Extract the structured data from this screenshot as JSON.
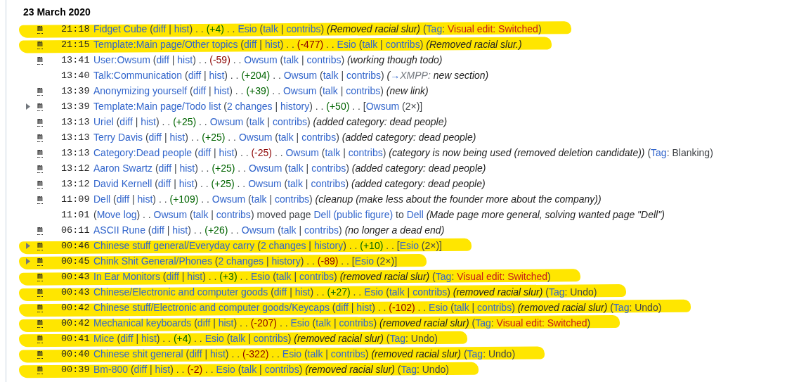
{
  "day": {
    "heading": "23 March 2020"
  },
  "rows": [
    {
      "highlighted": true,
      "expandable": false,
      "minor_flag": "m",
      "time": "21:18",
      "parts": [
        {
          "kind": "link",
          "text": "Fidget Cube"
        },
        {
          "kind": "text",
          "text": " ("
        },
        {
          "kind": "link",
          "text": "diff"
        },
        {
          "kind": "text",
          "text": " | "
        },
        {
          "kind": "link",
          "text": "hist"
        },
        {
          "kind": "text",
          "text": ") . . "
        },
        {
          "kind": "plus",
          "text": "(+4)"
        },
        {
          "kind": "text",
          "text": " . . "
        },
        {
          "kind": "link",
          "text": "Esio"
        },
        {
          "kind": "text",
          "text": " ("
        },
        {
          "kind": "link",
          "text": "talk"
        },
        {
          "kind": "text",
          "text": " | "
        },
        {
          "kind": "link",
          "text": "contribs"
        },
        {
          "kind": "text",
          "text": ") "
        },
        {
          "kind": "comment",
          "text": "(Removed racial slur)"
        },
        {
          "kind": "text",
          "text": " ("
        },
        {
          "kind": "link",
          "text": "Tag"
        },
        {
          "kind": "text",
          "text": ": "
        },
        {
          "kind": "tag",
          "text": "Visual edit: Switched"
        },
        {
          "kind": "text",
          "text": ")"
        }
      ]
    },
    {
      "highlighted": true,
      "expandable": false,
      "minor_flag": "m",
      "time": "21:15",
      "parts": [
        {
          "kind": "link",
          "text": "Template:Main page/Other topics"
        },
        {
          "kind": "text",
          "text": " ("
        },
        {
          "kind": "link",
          "text": "diff"
        },
        {
          "kind": "text",
          "text": " | "
        },
        {
          "kind": "link",
          "text": "hist"
        },
        {
          "kind": "text",
          "text": ") . . "
        },
        {
          "kind": "minus",
          "text": "(-477)"
        },
        {
          "kind": "text",
          "text": " . . "
        },
        {
          "kind": "link",
          "text": "Esio"
        },
        {
          "kind": "text",
          "text": " ("
        },
        {
          "kind": "link",
          "text": "talk"
        },
        {
          "kind": "text",
          "text": " | "
        },
        {
          "kind": "link",
          "text": "contribs"
        },
        {
          "kind": "text",
          "text": ") "
        },
        {
          "kind": "comment",
          "text": "(Removed racial slur.)"
        }
      ]
    },
    {
      "highlighted": false,
      "expandable": false,
      "minor_flag": "m",
      "time": "13:41",
      "parts": [
        {
          "kind": "link",
          "text": "User:Owsum"
        },
        {
          "kind": "text",
          "text": " ("
        },
        {
          "kind": "link",
          "text": "diff"
        },
        {
          "kind": "text",
          "text": " | "
        },
        {
          "kind": "link",
          "text": "hist"
        },
        {
          "kind": "text",
          "text": ") . . "
        },
        {
          "kind": "minus",
          "text": "(-59)"
        },
        {
          "kind": "text",
          "text": " . . "
        },
        {
          "kind": "link",
          "text": "Owsum"
        },
        {
          "kind": "text",
          "text": " ("
        },
        {
          "kind": "link",
          "text": "talk"
        },
        {
          "kind": "text",
          "text": " | "
        },
        {
          "kind": "link",
          "text": "contribs"
        },
        {
          "kind": "text",
          "text": ") "
        },
        {
          "kind": "comment",
          "text": "(working though todo)"
        }
      ]
    },
    {
      "highlighted": false,
      "expandable": false,
      "time": "13:40",
      "parts": [
        {
          "kind": "link",
          "text": "Talk:Communication"
        },
        {
          "kind": "text",
          "text": " ("
        },
        {
          "kind": "link",
          "text": "diff"
        },
        {
          "kind": "text",
          "text": " | "
        },
        {
          "kind": "link",
          "text": "hist"
        },
        {
          "kind": "text",
          "text": ") . . "
        },
        {
          "kind": "plus",
          "text": "(+204)"
        },
        {
          "kind": "text",
          "text": " . . "
        },
        {
          "kind": "link",
          "text": "Owsum"
        },
        {
          "kind": "text",
          "text": " ("
        },
        {
          "kind": "link",
          "text": "talk"
        },
        {
          "kind": "text",
          "text": " | "
        },
        {
          "kind": "link",
          "text": "contribs"
        },
        {
          "kind": "text",
          "text": ") "
        },
        {
          "kind": "comment",
          "text": "("
        },
        {
          "kind": "link",
          "text": "→"
        },
        {
          "kind": "muted",
          "text": "XMPP:"
        },
        {
          "kind": "comment",
          "text": " new section)"
        }
      ]
    },
    {
      "highlighted": false,
      "expandable": false,
      "minor_flag": "m",
      "time": "13:39",
      "parts": [
        {
          "kind": "link",
          "text": "Anonymizing yourself"
        },
        {
          "kind": "text",
          "text": " ("
        },
        {
          "kind": "link",
          "text": "diff"
        },
        {
          "kind": "text",
          "text": " | "
        },
        {
          "kind": "link",
          "text": "hist"
        },
        {
          "kind": "text",
          "text": ") . . "
        },
        {
          "kind": "plus",
          "text": "(+39)"
        },
        {
          "kind": "text",
          "text": " . . "
        },
        {
          "kind": "link",
          "text": "Owsum"
        },
        {
          "kind": "text",
          "text": " ("
        },
        {
          "kind": "link",
          "text": "talk"
        },
        {
          "kind": "text",
          "text": " | "
        },
        {
          "kind": "link",
          "text": "contribs"
        },
        {
          "kind": "text",
          "text": ") "
        },
        {
          "kind": "comment",
          "text": "(new link)"
        }
      ]
    },
    {
      "highlighted": false,
      "expandable": true,
      "minor_flag": "m",
      "time": "13:39",
      "parts": [
        {
          "kind": "link",
          "text": "Template:Main page/Todo list"
        },
        {
          "kind": "text",
          "text": " ("
        },
        {
          "kind": "link",
          "text": "2 changes"
        },
        {
          "kind": "text",
          "text": " | "
        },
        {
          "kind": "link",
          "text": "history"
        },
        {
          "kind": "text",
          "text": ") . . "
        },
        {
          "kind": "plus",
          "text": "(+50)"
        },
        {
          "kind": "text",
          "text": " . . ["
        },
        {
          "kind": "link",
          "text": "Owsum"
        },
        {
          "kind": "text",
          "text": " (2×)]"
        }
      ]
    },
    {
      "highlighted": false,
      "expandable": false,
      "minor_flag": "m",
      "time": "13:13",
      "parts": [
        {
          "kind": "link",
          "text": "Uriel"
        },
        {
          "kind": "text",
          "text": " ("
        },
        {
          "kind": "link",
          "text": "diff"
        },
        {
          "kind": "text",
          "text": " | "
        },
        {
          "kind": "link",
          "text": "hist"
        },
        {
          "kind": "text",
          "text": ") . . "
        },
        {
          "kind": "plus",
          "text": "(+25)"
        },
        {
          "kind": "text",
          "text": " . . "
        },
        {
          "kind": "link",
          "text": "Owsum"
        },
        {
          "kind": "text",
          "text": " ("
        },
        {
          "kind": "link",
          "text": "talk"
        },
        {
          "kind": "text",
          "text": " | "
        },
        {
          "kind": "link",
          "text": "contribs"
        },
        {
          "kind": "text",
          "text": ") "
        },
        {
          "kind": "comment",
          "text": "(added category: dead people)"
        }
      ]
    },
    {
      "highlighted": false,
      "expandable": false,
      "minor_flag": "m",
      "time": "13:13",
      "parts": [
        {
          "kind": "link",
          "text": "Terry Davis"
        },
        {
          "kind": "text",
          "text": " ("
        },
        {
          "kind": "link",
          "text": "diff"
        },
        {
          "kind": "text",
          "text": " | "
        },
        {
          "kind": "link",
          "text": "hist"
        },
        {
          "kind": "text",
          "text": ") . . "
        },
        {
          "kind": "plus",
          "text": "(+25)"
        },
        {
          "kind": "text",
          "text": " . . "
        },
        {
          "kind": "link",
          "text": "Owsum"
        },
        {
          "kind": "text",
          "text": " ("
        },
        {
          "kind": "link",
          "text": "talk"
        },
        {
          "kind": "text",
          "text": " | "
        },
        {
          "kind": "link",
          "text": "contribs"
        },
        {
          "kind": "text",
          "text": ") "
        },
        {
          "kind": "comment",
          "text": "(added category: dead people)"
        }
      ]
    },
    {
      "highlighted": false,
      "expandable": false,
      "minor_flag": "m",
      "time": "13:13",
      "parts": [
        {
          "kind": "link",
          "text": "Category:Dead people"
        },
        {
          "kind": "text",
          "text": " ("
        },
        {
          "kind": "link",
          "text": "diff"
        },
        {
          "kind": "text",
          "text": " | "
        },
        {
          "kind": "link",
          "text": "hist"
        },
        {
          "kind": "text",
          "text": ") . . "
        },
        {
          "kind": "minus",
          "text": "(-25)"
        },
        {
          "kind": "text",
          "text": " . . "
        },
        {
          "kind": "link",
          "text": "Owsum"
        },
        {
          "kind": "text",
          "text": " ("
        },
        {
          "kind": "link",
          "text": "talk"
        },
        {
          "kind": "text",
          "text": " | "
        },
        {
          "kind": "link",
          "text": "contribs"
        },
        {
          "kind": "text",
          "text": ") "
        },
        {
          "kind": "comment",
          "text": "(category is now being used (removed deletion candidate))"
        },
        {
          "kind": "text",
          "text": " ("
        },
        {
          "kind": "link",
          "text": "Tag"
        },
        {
          "kind": "text",
          "text": ": Blanking)"
        }
      ]
    },
    {
      "highlighted": false,
      "expandable": false,
      "minor_flag": "m",
      "time": "13:12",
      "parts": [
        {
          "kind": "link",
          "text": "Aaron Swartz"
        },
        {
          "kind": "text",
          "text": " ("
        },
        {
          "kind": "link",
          "text": "diff"
        },
        {
          "kind": "text",
          "text": " | "
        },
        {
          "kind": "link",
          "text": "hist"
        },
        {
          "kind": "text",
          "text": ") . . "
        },
        {
          "kind": "plus",
          "text": "(+25)"
        },
        {
          "kind": "text",
          "text": " . . "
        },
        {
          "kind": "link",
          "text": "Owsum"
        },
        {
          "kind": "text",
          "text": " ("
        },
        {
          "kind": "link",
          "text": "talk"
        },
        {
          "kind": "text",
          "text": " | "
        },
        {
          "kind": "link",
          "text": "contribs"
        },
        {
          "kind": "text",
          "text": ") "
        },
        {
          "kind": "comment",
          "text": "(added category: dead people)"
        }
      ]
    },
    {
      "highlighted": false,
      "expandable": false,
      "minor_flag": "m",
      "time": "13:12",
      "parts": [
        {
          "kind": "link",
          "text": "David Kernell"
        },
        {
          "kind": "text",
          "text": " ("
        },
        {
          "kind": "link",
          "text": "diff"
        },
        {
          "kind": "text",
          "text": " | "
        },
        {
          "kind": "link",
          "text": "hist"
        },
        {
          "kind": "text",
          "text": ") . . "
        },
        {
          "kind": "plus",
          "text": "(+25)"
        },
        {
          "kind": "text",
          "text": " . . "
        },
        {
          "kind": "link",
          "text": "Owsum"
        },
        {
          "kind": "text",
          "text": " ("
        },
        {
          "kind": "link",
          "text": "talk"
        },
        {
          "kind": "text",
          "text": " | "
        },
        {
          "kind": "link",
          "text": "contribs"
        },
        {
          "kind": "text",
          "text": ") "
        },
        {
          "kind": "comment",
          "text": "(added category: dead people)"
        }
      ]
    },
    {
      "highlighted": false,
      "expandable": false,
      "minor_flag": "m",
      "time": "11:09",
      "parts": [
        {
          "kind": "link",
          "text": "Dell"
        },
        {
          "kind": "text",
          "text": " ("
        },
        {
          "kind": "link",
          "text": "diff"
        },
        {
          "kind": "text",
          "text": " | "
        },
        {
          "kind": "link",
          "text": "hist"
        },
        {
          "kind": "text",
          "text": ") . . "
        },
        {
          "kind": "plus",
          "text": "(+109)"
        },
        {
          "kind": "text",
          "text": " . . "
        },
        {
          "kind": "link",
          "text": "Owsum"
        },
        {
          "kind": "text",
          "text": " ("
        },
        {
          "kind": "link",
          "text": "talk"
        },
        {
          "kind": "text",
          "text": " | "
        },
        {
          "kind": "link",
          "text": "contribs"
        },
        {
          "kind": "text",
          "text": ") "
        },
        {
          "kind": "comment",
          "text": "(cleanup (make less about the founder more about the company))"
        }
      ]
    },
    {
      "highlighted": false,
      "expandable": false,
      "time": "11:01",
      "parts": [
        {
          "kind": "text",
          "text": "("
        },
        {
          "kind": "link",
          "text": "Move log"
        },
        {
          "kind": "text",
          "text": ") . . "
        },
        {
          "kind": "link",
          "text": "Owsum"
        },
        {
          "kind": "text",
          "text": " ("
        },
        {
          "kind": "link",
          "text": "talk"
        },
        {
          "kind": "text",
          "text": " | "
        },
        {
          "kind": "link",
          "text": "contribs"
        },
        {
          "kind": "text",
          "text": ") moved page "
        },
        {
          "kind": "link",
          "text": "Dell (public figure)"
        },
        {
          "kind": "text",
          "text": " to "
        },
        {
          "kind": "link",
          "text": "Dell"
        },
        {
          "kind": "comment",
          "text": " (Made page more general, solving wanted page \"Dell\")"
        }
      ]
    },
    {
      "highlighted": false,
      "expandable": false,
      "minor_flag": "m",
      "time": "06:11",
      "parts": [
        {
          "kind": "link",
          "text": "ASCII Rune"
        },
        {
          "kind": "text",
          "text": " ("
        },
        {
          "kind": "link",
          "text": "diff"
        },
        {
          "kind": "text",
          "text": " | "
        },
        {
          "kind": "link",
          "text": "hist"
        },
        {
          "kind": "text",
          "text": ") . . "
        },
        {
          "kind": "plus",
          "text": "(+26)"
        },
        {
          "kind": "text",
          "text": " . . "
        },
        {
          "kind": "link",
          "text": "Owsum"
        },
        {
          "kind": "text",
          "text": " ("
        },
        {
          "kind": "link",
          "text": "talk"
        },
        {
          "kind": "text",
          "text": " | "
        },
        {
          "kind": "link",
          "text": "contribs"
        },
        {
          "kind": "text",
          "text": ") "
        },
        {
          "kind": "comment",
          "text": "(no longer a dead end)"
        }
      ]
    },
    {
      "highlighted": true,
      "expandable": true,
      "minor_flag": "m",
      "time": "00:46",
      "parts": [
        {
          "kind": "link",
          "text": "Chinese stuff general/Everyday carry"
        },
        {
          "kind": "text",
          "text": " ("
        },
        {
          "kind": "link",
          "text": "2 changes"
        },
        {
          "kind": "text",
          "text": " | "
        },
        {
          "kind": "link",
          "text": "history"
        },
        {
          "kind": "text",
          "text": ") . . "
        },
        {
          "kind": "plus",
          "text": "(+10)"
        },
        {
          "kind": "text",
          "text": " . . ["
        },
        {
          "kind": "link",
          "text": "Esio"
        },
        {
          "kind": "text",
          "text": " (2×)]"
        }
      ]
    },
    {
      "highlighted": true,
      "expandable": true,
      "minor_flag": "m",
      "time": "00:45",
      "parts": [
        {
          "kind": "link",
          "text": "Chink Shit General/Phones"
        },
        {
          "kind": "text",
          "text": " ("
        },
        {
          "kind": "link",
          "text": "2 changes"
        },
        {
          "kind": "text",
          "text": " | "
        },
        {
          "kind": "link",
          "text": "history"
        },
        {
          "kind": "text",
          "text": ") . . "
        },
        {
          "kind": "minus",
          "text": "(-89)"
        },
        {
          "kind": "text",
          "text": " . . ["
        },
        {
          "kind": "link",
          "text": "Esio"
        },
        {
          "kind": "text",
          "text": " (2×)]"
        }
      ]
    },
    {
      "highlighted": true,
      "expandable": false,
      "minor_flag": "m",
      "time": "00:43",
      "parts": [
        {
          "kind": "link",
          "text": "In Ear Monitors"
        },
        {
          "kind": "text",
          "text": " ("
        },
        {
          "kind": "link",
          "text": "diff"
        },
        {
          "kind": "text",
          "text": " | "
        },
        {
          "kind": "link",
          "text": "hist"
        },
        {
          "kind": "text",
          "text": ") . . "
        },
        {
          "kind": "plus",
          "text": "(+3)"
        },
        {
          "kind": "text",
          "text": " . . "
        },
        {
          "kind": "link",
          "text": "Esio"
        },
        {
          "kind": "text",
          "text": " ("
        },
        {
          "kind": "link",
          "text": "talk"
        },
        {
          "kind": "text",
          "text": " | "
        },
        {
          "kind": "link",
          "text": "contribs"
        },
        {
          "kind": "text",
          "text": ") "
        },
        {
          "kind": "comment",
          "text": "(removed racial slur)"
        },
        {
          "kind": "text",
          "text": " ("
        },
        {
          "kind": "link",
          "text": "Tag"
        },
        {
          "kind": "text",
          "text": ": "
        },
        {
          "kind": "tag",
          "text": "Visual edit: Switched"
        },
        {
          "kind": "text",
          "text": ")"
        }
      ]
    },
    {
      "highlighted": true,
      "expandable": false,
      "minor_flag": "m",
      "time": "00:43",
      "parts": [
        {
          "kind": "link",
          "text": "Chinese/Electronic and computer goods"
        },
        {
          "kind": "text",
          "text": " ("
        },
        {
          "kind": "link",
          "text": "diff"
        },
        {
          "kind": "text",
          "text": " | "
        },
        {
          "kind": "link",
          "text": "hist"
        },
        {
          "kind": "text",
          "text": ") . . "
        },
        {
          "kind": "plus",
          "text": "(+27)"
        },
        {
          "kind": "text",
          "text": " . . "
        },
        {
          "kind": "link",
          "text": "Esio"
        },
        {
          "kind": "text",
          "text": " ("
        },
        {
          "kind": "link",
          "text": "talk"
        },
        {
          "kind": "text",
          "text": " | "
        },
        {
          "kind": "link",
          "text": "contribs"
        },
        {
          "kind": "text",
          "text": ") "
        },
        {
          "kind": "comment",
          "text": "(removed racial slur)"
        },
        {
          "kind": "text",
          "text": " ("
        },
        {
          "kind": "link",
          "text": "Tag"
        },
        {
          "kind": "text",
          "text": ": Undo)"
        }
      ]
    },
    {
      "highlighted": true,
      "expandable": false,
      "minor_flag": "m",
      "time": "00:42",
      "parts": [
        {
          "kind": "link",
          "text": "Chinese stuff/Electronic and computer goods/Keycaps"
        },
        {
          "kind": "text",
          "text": " ("
        },
        {
          "kind": "link",
          "text": "diff"
        },
        {
          "kind": "text",
          "text": " | "
        },
        {
          "kind": "link",
          "text": "hist"
        },
        {
          "kind": "text",
          "text": ") . . "
        },
        {
          "kind": "minus",
          "text": "(-102)"
        },
        {
          "kind": "text",
          "text": " . . "
        },
        {
          "kind": "link",
          "text": "Esio"
        },
        {
          "kind": "text",
          "text": " ("
        },
        {
          "kind": "link",
          "text": "talk"
        },
        {
          "kind": "text",
          "text": " | "
        },
        {
          "kind": "link",
          "text": "contribs"
        },
        {
          "kind": "text",
          "text": ") "
        },
        {
          "kind": "comment",
          "text": "(removed racial slur)"
        },
        {
          "kind": "text",
          "text": " ("
        },
        {
          "kind": "link",
          "text": "Tag"
        },
        {
          "kind": "text",
          "text": ": Undo)"
        }
      ]
    },
    {
      "highlighted": true,
      "expandable": false,
      "minor_flag": "m",
      "time": "00:42",
      "parts": [
        {
          "kind": "link",
          "text": "Mechanical keyboards"
        },
        {
          "kind": "text",
          "text": " ("
        },
        {
          "kind": "link",
          "text": "diff"
        },
        {
          "kind": "text",
          "text": " | "
        },
        {
          "kind": "link",
          "text": "hist"
        },
        {
          "kind": "text",
          "text": ") . . "
        },
        {
          "kind": "minus",
          "text": "(-207)"
        },
        {
          "kind": "text",
          "text": " . . "
        },
        {
          "kind": "link",
          "text": "Esio"
        },
        {
          "kind": "text",
          "text": " ("
        },
        {
          "kind": "link",
          "text": "talk"
        },
        {
          "kind": "text",
          "text": " | "
        },
        {
          "kind": "link",
          "text": "contribs"
        },
        {
          "kind": "text",
          "text": ") "
        },
        {
          "kind": "comment",
          "text": "(removed racial slur)"
        },
        {
          "kind": "text",
          "text": " ("
        },
        {
          "kind": "link",
          "text": "Tag"
        },
        {
          "kind": "text",
          "text": ": "
        },
        {
          "kind": "tag",
          "text": "Visual edit: Switched"
        },
        {
          "kind": "text",
          "text": ")"
        }
      ]
    },
    {
      "highlighted": true,
      "expandable": false,
      "minor_flag": "m",
      "time": "00:41",
      "parts": [
        {
          "kind": "link",
          "text": "Mice"
        },
        {
          "kind": "text",
          "text": " ("
        },
        {
          "kind": "link",
          "text": "diff"
        },
        {
          "kind": "text",
          "text": " | "
        },
        {
          "kind": "link",
          "text": "hist"
        },
        {
          "kind": "text",
          "text": ") . . "
        },
        {
          "kind": "plus",
          "text": "(+4)"
        },
        {
          "kind": "text",
          "text": " . . "
        },
        {
          "kind": "link",
          "text": "Esio"
        },
        {
          "kind": "text",
          "text": " ("
        },
        {
          "kind": "link",
          "text": "talk"
        },
        {
          "kind": "text",
          "text": " | "
        },
        {
          "kind": "link",
          "text": "contribs"
        },
        {
          "kind": "text",
          "text": ") "
        },
        {
          "kind": "comment",
          "text": "(removed racial slur)"
        },
        {
          "kind": "text",
          "text": " ("
        },
        {
          "kind": "link",
          "text": "Tag"
        },
        {
          "kind": "text",
          "text": ": Undo)"
        }
      ]
    },
    {
      "highlighted": true,
      "expandable": false,
      "minor_flag": "m",
      "time": "00:40",
      "parts": [
        {
          "kind": "link",
          "text": "Chinese shit general"
        },
        {
          "kind": "text",
          "text": " ("
        },
        {
          "kind": "link",
          "text": "diff"
        },
        {
          "kind": "text",
          "text": " | "
        },
        {
          "kind": "link",
          "text": "hist"
        },
        {
          "kind": "text",
          "text": ") . . "
        },
        {
          "kind": "minus",
          "text": "(-322)"
        },
        {
          "kind": "text",
          "text": " . . "
        },
        {
          "kind": "link",
          "text": "Esio"
        },
        {
          "kind": "text",
          "text": " ("
        },
        {
          "kind": "link",
          "text": "talk"
        },
        {
          "kind": "text",
          "text": " | "
        },
        {
          "kind": "link",
          "text": "contribs"
        },
        {
          "kind": "text",
          "text": ") "
        },
        {
          "kind": "comment",
          "text": "(removed racial slur)"
        },
        {
          "kind": "text",
          "text": " ("
        },
        {
          "kind": "link",
          "text": "Tag"
        },
        {
          "kind": "text",
          "text": ": Undo)"
        }
      ]
    },
    {
      "highlighted": true,
      "expandable": false,
      "minor_flag": "m",
      "time": "00:39",
      "parts": [
        {
          "kind": "link",
          "text": "Bm-800"
        },
        {
          "kind": "text",
          "text": " ("
        },
        {
          "kind": "link",
          "text": "diff"
        },
        {
          "kind": "text",
          "text": " | "
        },
        {
          "kind": "link",
          "text": "hist"
        },
        {
          "kind": "text",
          "text": ") . . "
        },
        {
          "kind": "minus",
          "text": "(-2)"
        },
        {
          "kind": "text",
          "text": " . . "
        },
        {
          "kind": "link",
          "text": "Esio"
        },
        {
          "kind": "text",
          "text": " ("
        },
        {
          "kind": "link",
          "text": "talk"
        },
        {
          "kind": "text",
          "text": " | "
        },
        {
          "kind": "link",
          "text": "contribs"
        },
        {
          "kind": "text",
          "text": ") "
        },
        {
          "kind": "comment",
          "text": "(removed racial slur)"
        },
        {
          "kind": "text",
          "text": " ("
        },
        {
          "kind": "link",
          "text": "Tag"
        },
        {
          "kind": "text",
          "text": ": Undo)"
        }
      ]
    }
  ]
}
